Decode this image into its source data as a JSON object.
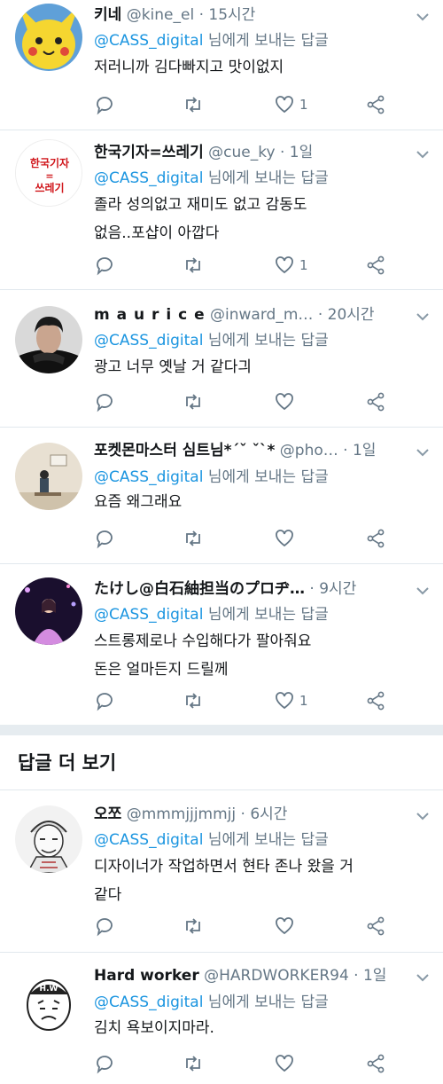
{
  "reply_prefix_mention": "@CASS_digital",
  "reply_prefix_rest": " 님에게 보내는 답글",
  "more_replies_label": "답글 더 보기",
  "colors": {
    "accent": "#1b95e0",
    "secondary_text": "#657786",
    "divider": "#e1e8ed",
    "separator": "#e6ecf0"
  },
  "tweets": [
    {
      "name": "키네",
      "handle": "@kine_el",
      "time": "15시간",
      "text": "저러니까 김다빠지고 맛이없지",
      "likes": "1",
      "avatar": "pikachu-avatar"
    },
    {
      "name": "한국기자=쓰레기",
      "handle": "@cue_ky",
      "time": "1일",
      "text": "졸라 성의없고 재미도 없고 감동도\n없음..포샵이 아깝다",
      "likes": "1",
      "avatar": "text-logo-avatar",
      "avatar_text": [
        "한국기자",
        "=",
        "쓰레기"
      ]
    },
    {
      "name": "m a u r i c e",
      "handle": "@inward_m…",
      "time": "20시간",
      "text": "광고 너무 옛날 거 같다긔",
      "likes": "",
      "avatar": "portrait-avatar"
    },
    {
      "name": "포켓몬마스터 심트님*ˊˇ ˇˋ*",
      "handle": "@pho…",
      "time": "1일",
      "text": "요즘 왜그래요",
      "likes": "",
      "avatar": "room-photo-avatar"
    },
    {
      "name": "たけし@白石紬担当のプロヂ…",
      "handle": "",
      "time": "9시간",
      "text": "스트롱제로나 수입해다가 팔아줘요\n돈은 얼마든지 드릴께",
      "likes": "1",
      "avatar": "stage-photo-avatar"
    },
    {
      "name": "오쪼",
      "handle": "@mmmjjjmmjj",
      "time": "6시간",
      "text": "디자이너가 작업하면서 현타 존나 왔을 거\n같다",
      "likes": "",
      "avatar": "sketch-avatar"
    },
    {
      "name": "Hard worker",
      "handle": "@HARDWORKER94",
      "time": "1일",
      "text": "김치 욕보이지마라.",
      "likes": "",
      "avatar": "meme-face-avatar",
      "avatar_text": [
        "H.W"
      ]
    }
  ]
}
